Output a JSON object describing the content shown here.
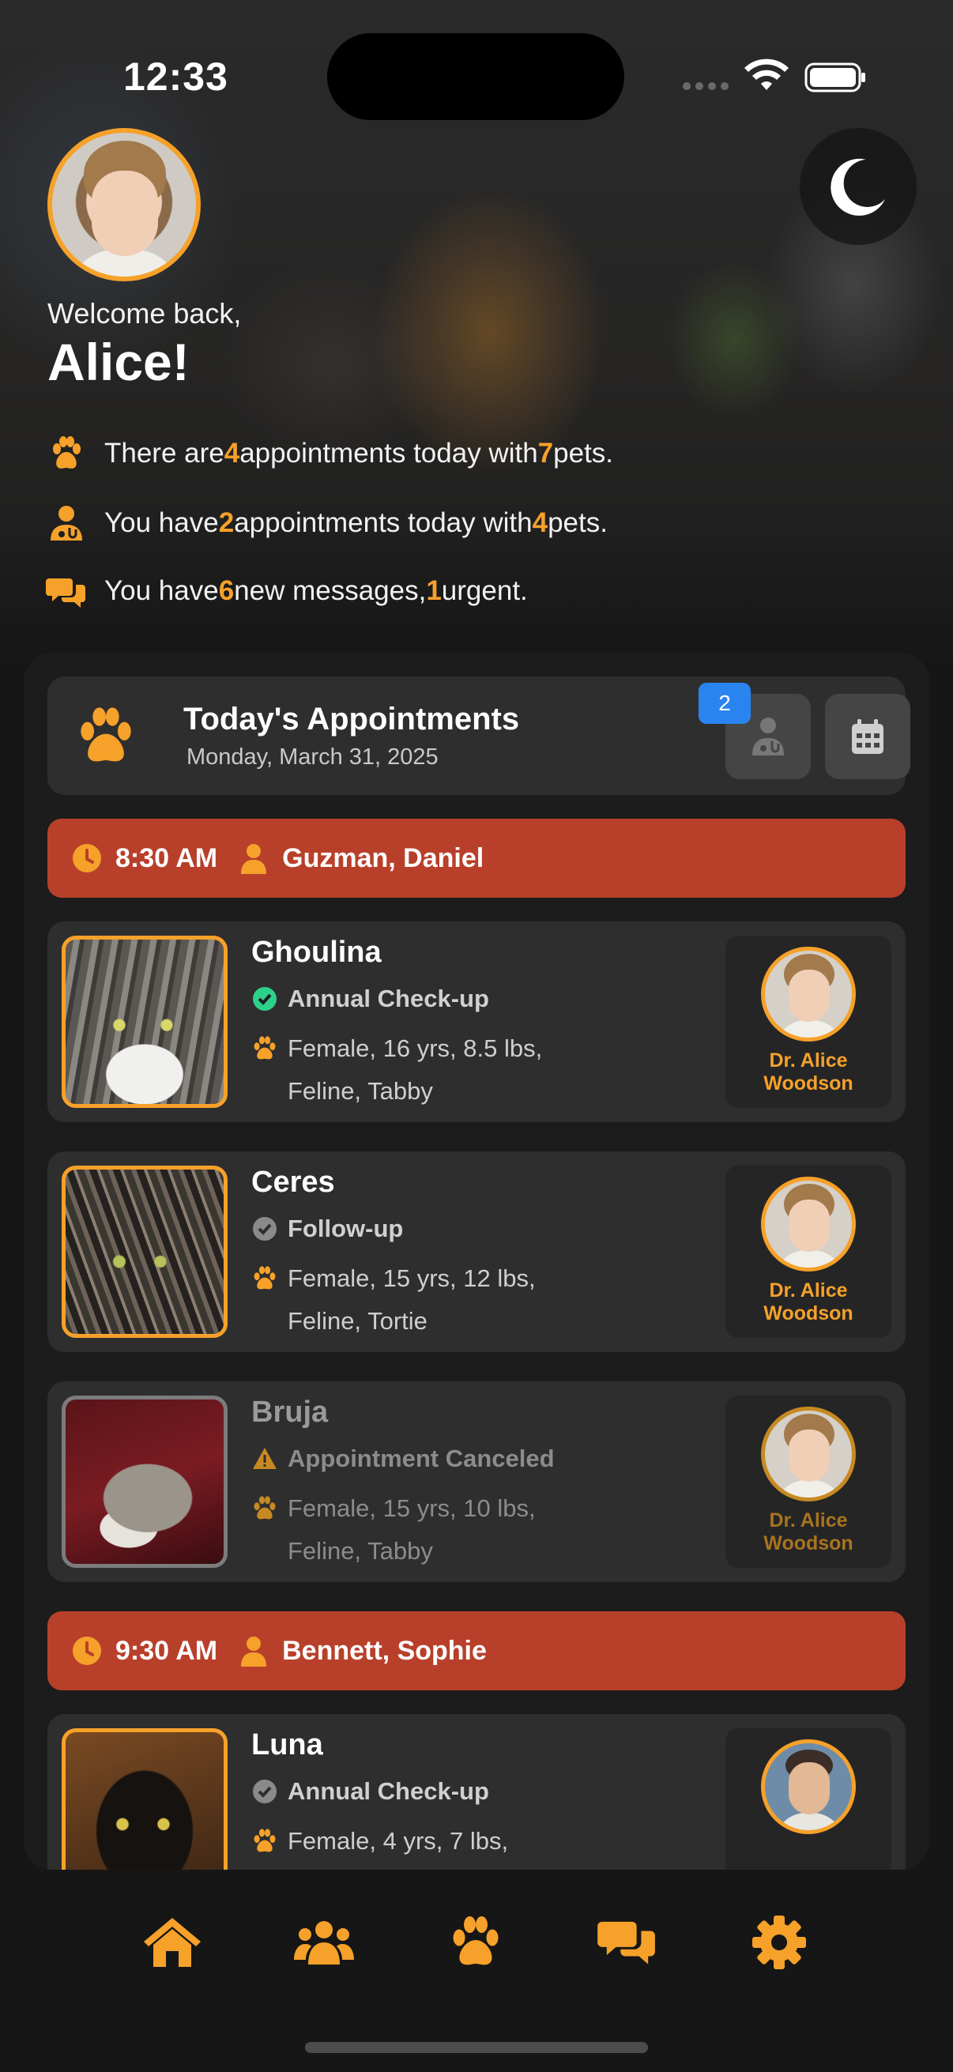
{
  "status_bar": {
    "time": "12:33"
  },
  "header": {
    "welcome": "Welcome back,",
    "username": "Alice!",
    "summaries": [
      {
        "icon": "paw-icon",
        "t1": "There are ",
        "n1": "4",
        "t2": " appointments today with ",
        "n2": "7",
        "t3": " pets."
      },
      {
        "icon": "vet-icon",
        "t1": "You have ",
        "n1": "2",
        "t2": " appointments today with ",
        "n2": "4",
        "t3": " pets."
      },
      {
        "icon": "chat-icon",
        "t1": "You have ",
        "n1": "6",
        "t2": " new messages, ",
        "n2": "1",
        "t3": " urgent."
      }
    ]
  },
  "today": {
    "title": "Today's Appointments",
    "date": "Monday, March 31, 2025",
    "vet_badge": "2"
  },
  "appointments": [
    {
      "time": "8:30 AM",
      "owner": "Guzman, Daniel",
      "pets": [
        {
          "name": "Ghoulina",
          "status": "Annual Check-up",
          "status_icon": "check-circle-icon",
          "info_line1": "Female, 16 yrs, 8.5 lbs,",
          "info_line2": "Feline, Tabby",
          "vet": "Dr. Alice Woodson"
        },
        {
          "name": "Ceres",
          "status": "Follow-up",
          "status_icon": "check-circle-icon",
          "info_line1": "Female, 15 yrs, 12 lbs,",
          "info_line2": "Feline, Tortie",
          "vet": "Dr. Alice Woodson"
        },
        {
          "name": "Bruja",
          "status": "Appointment Canceled",
          "status_icon": "warning-icon",
          "info_line1": "Female, 15 yrs, 10 lbs,",
          "info_line2": "Feline, Tabby",
          "vet": "Dr. Alice Woodson"
        }
      ]
    },
    {
      "time": "9:30 AM",
      "owner": "Bennett, Sophie",
      "pets": [
        {
          "name": "Luna",
          "status": "Annual Check-up",
          "status_icon": "check-circle-icon",
          "info_line1": "Female, 4 yrs, 7 lbs,",
          "info_line2": "",
          "vet": ""
        }
      ]
    }
  ],
  "nav": [
    "home-icon",
    "clients-icon",
    "pets-icon",
    "messages-icon",
    "settings-icon"
  ],
  "colors": {
    "accent": "#f6a12a",
    "time_bar": "#b8402a",
    "badge": "#2a84f0",
    "confirmed": "#2ed18a",
    "card": "#2e2e2e"
  }
}
